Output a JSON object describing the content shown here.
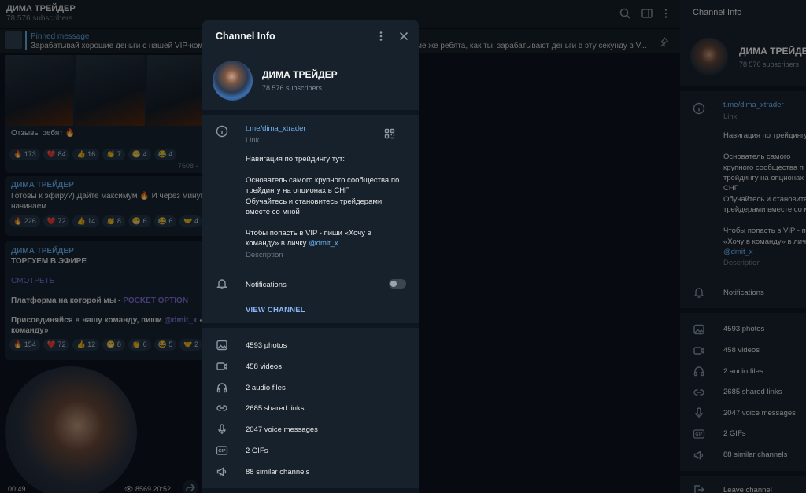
{
  "chat": {
    "title": "ДИМА ТРЕЙДЕР",
    "subscribers": "78 576 subscribers",
    "pinned_label": "Pinned message",
    "pinned_text": "Зарабатывай хорошие деньги с нашей VIP-ком",
    "pinned_text_cont": "такие же ребята, как ты, зарабатывают деньги в эту секунду в V...",
    "messages": [
      {
        "lines": [
          "Отзывы ребят 🔥"
        ],
        "reactions": [
          "🔥 173",
          "❤️ 84",
          "👍 16",
          "👏 7",
          "😁 4",
          "😂 4"
        ],
        "views": "7608 -"
      },
      {
        "author": "ДИМА ТРЕЙДЕР",
        "lines": [
          "Готовы к эфиру?) Дайте максимум 🔥 И через минут",
          "начинаем"
        ],
        "reactions": [
          "🔥 226",
          "❤️ 72",
          "👍 14",
          "👏 8",
          "😁 6",
          "😂 6",
          "🤝 4"
        ]
      },
      {
        "author": "ДИМА ТРЕЙДЕР",
        "title": "ТОРГУЕМ В ЭФИРЕ",
        "watch": "СМОТРЕТЬ",
        "platform_prefix": "Платформа на которой мы - ",
        "platform_link": "POCKET OPTION",
        "join_prefix": "Присоединяйся в нашу команду, пиши ",
        "join_mention": "@dmit_x",
        "join_suffix": " «Хоч",
        "join_line2": "команду»",
        "reactions": [
          "🔥 154",
          "❤️ 72",
          "👍 12",
          "😁 8",
          "👏 6",
          "😂 5",
          "🤝 2"
        ]
      }
    ],
    "video": {
      "duration": "00:49",
      "views": "8569",
      "time": "20:52"
    }
  },
  "side_panel": {
    "title": "Channel Info",
    "name": "ДИМА ТРЕЙДЕР",
    "subscribers": "78 576 subscribers",
    "link": "t.me/dima_xtrader",
    "link_label": "Link",
    "desc_lines": [
      "Навигация по трейдингу",
      "",
      "Основатель самого",
      "крупного сообщества п",
      "трейдингу на опционах",
      "СНГ",
      "Обучайтесь и становите",
      "трейдерами вместе со м",
      "",
      "Чтобы попасть в VIP - пиш",
      "«Хочу в команду» в личку"
    ],
    "desc_mention": "@dmit_x",
    "desc_label": "Description",
    "notifications": "Notifications",
    "media": [
      "4593 photos",
      "458 videos",
      "2 audio files",
      "2685 shared links",
      "2047 voice messages",
      "2 GIFs",
      "88 similar channels"
    ],
    "leave": "Leave channel"
  },
  "modal": {
    "title": "Channel Info",
    "name": "ДИМА ТРЕЙДЕР",
    "subscribers": "78 576 subscribers",
    "link": "t.me/dima_xtrader",
    "link_label": "Link",
    "description": {
      "heading": "Навигация по трейдингу тут:",
      "line1": "Основатель самого крупного сообщества по",
      "line2": "трейдингу на опционах в СНГ",
      "line3": "Обучайтесь и становитесь трейдерами",
      "line4": "вместе со мной",
      "line5": "Чтобы попасть в VIP - пиши «Хочу в",
      "line6_prefix": "команду» в личку ",
      "line6_mention": "@dmit_x",
      "label": "Description"
    },
    "notifications_label": "Notifications",
    "notifications_on": false,
    "view_channel": "VIEW CHANNEL",
    "media": {
      "photos": "4593 photos",
      "videos": "458 videos",
      "audio": "2 audio files",
      "links": "2685 shared links",
      "voice": "2047 voice messages",
      "gifs": "2 GIFs",
      "similar": "88 similar channels"
    }
  },
  "icons": [
    "search-icon",
    "sidebar-toggle-icon",
    "more-vertical-icon",
    "pin-icon",
    "close-icon",
    "info-icon",
    "qr-code-icon",
    "bell-icon",
    "photo-icon",
    "video-icon",
    "headphones-icon",
    "link-icon",
    "microphone-icon",
    "gif-icon",
    "megaphone-icon",
    "share-icon",
    "leave-icon"
  ],
  "colors": {
    "background": "#0e1621",
    "panel": "#17212b",
    "accent": "#6ab3f3",
    "view_channel": "#8ab4f8",
    "link_purple": "#8774e1"
  }
}
